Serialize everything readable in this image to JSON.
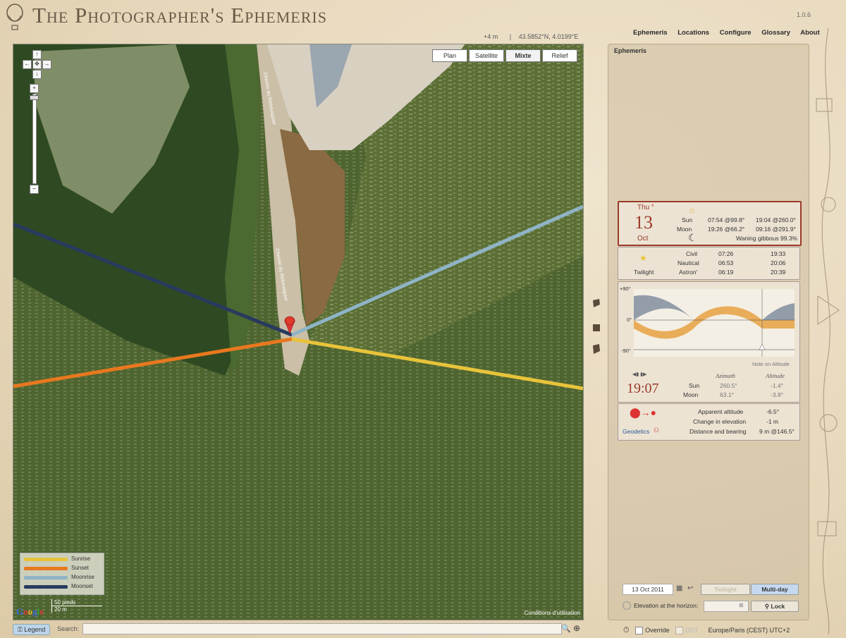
{
  "app": {
    "title": "The Photographer's Ephemeris",
    "version": "1.0.6"
  },
  "coords": {
    "elevation": "+4 m",
    "sep": "|",
    "latlon": "43.5852°N, 4.0199°E"
  },
  "nav": [
    "Ephemeris",
    "Locations",
    "Configure",
    "Glossary",
    "About"
  ],
  "map": {
    "types": [
      "Plan",
      "Satellite",
      "Mixte",
      "Relief"
    ],
    "selected_type": "Mixte",
    "road_label": "Chemin du Rebousquier",
    "legend": [
      {
        "label": "Sunrise",
        "color": "#e8c33a"
      },
      {
        "label": "Sunset",
        "color": "#e9781e"
      },
      {
        "label": "Moonrise",
        "color": "#8fb4c7"
      },
      {
        "label": "Moonset",
        "color": "#283a5e"
      }
    ],
    "google": "Google",
    "scale_top": "50 pieds",
    "scale_bottom": "20 m",
    "terms": "Conditions d'utilisation"
  },
  "bottom": {
    "legend_btn": "Legend",
    "search_label": "Search:",
    "search_value": ""
  },
  "panel": {
    "title": "Ephemeris",
    "date": {
      "weekday": "Thu",
      "day": "13",
      "month": "Oct",
      "asterisk": "*"
    },
    "sun": {
      "label": "Sun",
      "rise": "07:54 @99.8°",
      "set": "19:04 @260.0°"
    },
    "moon": {
      "label": "Moon",
      "rise": "19:26 @66.2°",
      "set": "09:16 @291.9°",
      "phase": "Waning gibbous 99.3%"
    },
    "twilight": {
      "label": "Twilight",
      "rows": [
        {
          "name": "Civil",
          "am": "07:26",
          "pm": "19:33"
        },
        {
          "name": "Nautical",
          "am": "06:53",
          "pm": "20:06"
        },
        {
          "name": "Astron'",
          "am": "06:19",
          "pm": "20:39"
        }
      ]
    },
    "graph": {
      "top": "+90°",
      "mid": "0°",
      "bottom": "-90°",
      "note": "Note on Altitude"
    },
    "time": "19:07",
    "az_header": "Azimuth",
    "alt_header": "Altitude",
    "sun_pos": {
      "label": "Sun",
      "az": "260.5°",
      "alt": "-1.4°"
    },
    "moon_pos": {
      "label": "Moon",
      "az": "63.1°",
      "alt": "-3.8°"
    },
    "geodetics": {
      "label": "Geodetics",
      "rows": [
        {
          "k": "Apparent altitude",
          "v": "-6.5°"
        },
        {
          "k": "Change in elevation",
          "v": "-1 m"
        },
        {
          "k": "Distance and bearing",
          "v": "9 m @146.5°"
        }
      ]
    },
    "date_input": "13 Oct 2011",
    "twilight_btn": "Twilight",
    "multiday_btn": "Multi-day",
    "elevation_label": "Elevation at the horizon:",
    "lock_btn": "Lock"
  },
  "footer": {
    "override": "Override",
    "dst": "DST",
    "timezone": "Europe/Paris (CEST) UTC+2"
  }
}
